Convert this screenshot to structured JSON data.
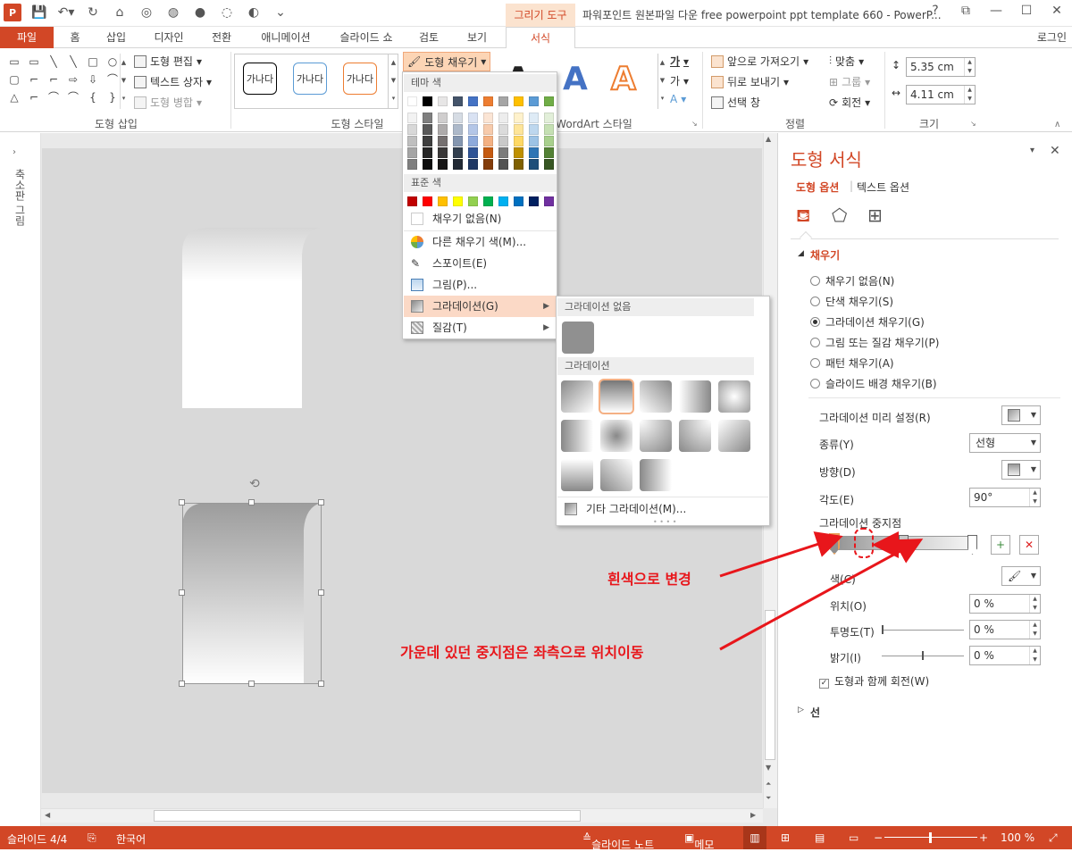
{
  "title_bar": {
    "context_tab": "그리기 도구",
    "doc_title": "파워포인트 원본파일 다운 free powerpoint ppt template 660 - PowerP...",
    "controls": [
      "?",
      "⧉",
      "—",
      "☐",
      "✕"
    ]
  },
  "tabs": {
    "file": "파일",
    "items": [
      "홈",
      "삽입",
      "디자인",
      "전환",
      "애니메이션",
      "슬라이드 쇼",
      "검토",
      "보기"
    ],
    "format": "서식",
    "login": "로그인"
  },
  "ribbon": {
    "insert_shapes": {
      "label": "도형 삽입",
      "edit_shape": "도형 편집",
      "text_box": "텍스트 상자",
      "merge_shapes": "도형 병합",
      "shape_glyphs": [
        "▭",
        "▭",
        "╲",
        "╲",
        "□",
        "○",
        "▢",
        "⌐",
        "⌐",
        "⇨",
        "⇩",
        "⌒",
        "△",
        "⌐",
        "⌒",
        "⌒",
        "{",
        "}"
      ]
    },
    "shape_styles": {
      "label": "도형 스타일",
      "samples": [
        "가나다",
        "가나다",
        "가나다"
      ],
      "fill_button": "도형 채우기"
    },
    "wordart": {
      "label": "WordArt 스타일",
      "letters": [
        "A",
        "A",
        "A"
      ],
      "text_fill_glyph": "가",
      "text_outline_glyph": "가"
    },
    "arrange": {
      "label": "정렬",
      "bring_forward": "앞으로 가져오기",
      "send_backward": "뒤로 보내기",
      "selection_pane": "선택 창",
      "align": "맞춤",
      "group": "그룹",
      "rotate": "회전"
    },
    "size": {
      "label": "크기",
      "height": "5.35 cm",
      "width": "4.11 cm"
    }
  },
  "thumb_panel": {
    "label": "축소판 그림"
  },
  "fill_menu": {
    "theme_header": "테마 색",
    "theme_colors": [
      "#ffffff",
      "#000000",
      "#e7e6e6",
      "#44546a",
      "#4472c4",
      "#ed7d31",
      "#a5a5a5",
      "#ffc000",
      "#5b9bd5",
      "#70ad47"
    ],
    "theme_shades": [
      [
        "#f2f2f2",
        "#7f7f7f",
        "#d0cece",
        "#d6dce4",
        "#d9e2f3",
        "#fbe5d5",
        "#ededed",
        "#fff2cc",
        "#deebf6",
        "#e2efd9"
      ],
      [
        "#d8d8d8",
        "#595959",
        "#aeabab",
        "#adb9ca",
        "#b4c6e7",
        "#f7cbac",
        "#dbdbdb",
        "#fee599",
        "#bdd7ee",
        "#c5e0b3"
      ],
      [
        "#bfbfbf",
        "#3f3f3f",
        "#757070",
        "#8496b0",
        "#8eaadb",
        "#f4b183",
        "#c9c9c9",
        "#ffd965",
        "#9cc3e5",
        "#a8d08d"
      ],
      [
        "#a5a5a5",
        "#262626",
        "#3a3838",
        "#323f4f",
        "#2f5496",
        "#c55a11",
        "#7b7b7b",
        "#bf9000",
        "#2e75b5",
        "#538135"
      ],
      [
        "#7f7f7f",
        "#0c0c0c",
        "#171616",
        "#222a35",
        "#1f3864",
        "#833c0b",
        "#525252",
        "#7f6000",
        "#1e4e79",
        "#375623"
      ]
    ],
    "standard_header": "표준 색",
    "standard_colors": [
      "#c00000",
      "#ff0000",
      "#ffc000",
      "#ffff00",
      "#92d050",
      "#00b050",
      "#00b0f0",
      "#0070c0",
      "#002060",
      "#7030a0"
    ],
    "no_fill": "채우기 없음(N)",
    "more_colors": "다른 채우기 색(M)...",
    "eyedropper": "스포이트(E)",
    "picture": "그림(P)...",
    "gradient": "그라데이션(G)",
    "texture": "질감(T)"
  },
  "gradient_menu": {
    "no_gradient_header": "그라데이션 없음",
    "gradient_header": "그라데이션",
    "more_gradients": "기타 그라데이션(M)..."
  },
  "pane": {
    "title": "도형 서식",
    "tab_shape": "도형 옵션",
    "tab_text": "텍스트 옵션",
    "fill_section": "채우기",
    "fill_options": [
      "채우기 없음(N)",
      "단색 채우기(S)",
      "그라데이션 채우기(G)",
      "그림 또는 질감 채우기(P)",
      "패턴 채우기(A)",
      "슬라이드 배경 채우기(B)"
    ],
    "selected_fill_index": 2,
    "preset_label": "그라데이션 미리 설정(R)",
    "type_label": "종류(Y)",
    "type_value": "선형",
    "direction_label": "방향(D)",
    "angle_label": "각도(E)",
    "angle_value": "90°",
    "stops_label": "그라데이션 중지점",
    "color_label": "색(C)",
    "position_label": "위치(O)",
    "position_value": "0 %",
    "transparency_label": "투명도(T)",
    "transparency_value": "0 %",
    "brightness_label": "밝기(I)",
    "brightness_value": "0 %",
    "rotate_with_shape": "도형과 함께 회전(W)",
    "line_section": "선"
  },
  "annotations": {
    "white_change": "흰색으로 변경",
    "move_middle_stop": "가운데 있던 중지점은 좌측으로 위치이동"
  },
  "status_bar": {
    "slide": "슬라이드 4/4",
    "language": "한국어",
    "notes": "슬라이드 노트",
    "comments": "메모",
    "zoom": "100 %"
  },
  "colors": {
    "accent": "#d24726",
    "annotation": "#e8161b"
  }
}
